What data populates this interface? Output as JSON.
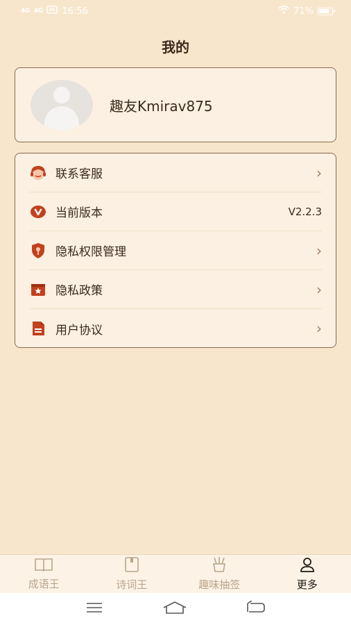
{
  "status": {
    "time": "16:56",
    "sig1": "4G",
    "sig2": "4G",
    "battery": "71%"
  },
  "page": {
    "title": "我的"
  },
  "profile": {
    "username": "趣友Kmirav875"
  },
  "menu": [
    {
      "label": "联系客服",
      "icon": "customer-service-icon",
      "right": ""
    },
    {
      "label": "当前版本",
      "icon": "version-icon",
      "right": "V2.2.3"
    },
    {
      "label": "隐私权限管理",
      "icon": "privacy-shield-icon",
      "right": ""
    },
    {
      "label": "隐私政策",
      "icon": "policy-star-icon",
      "right": ""
    },
    {
      "label": "用户协议",
      "icon": "document-icon",
      "right": ""
    }
  ],
  "tabs": [
    {
      "label": "成语王",
      "icon": "book-icon",
      "active": false
    },
    {
      "label": "诗词王",
      "icon": "notebook-icon",
      "active": false
    },
    {
      "label": "趣味抽签",
      "icon": "lottery-icon",
      "active": false
    },
    {
      "label": "更多",
      "icon": "user-icon",
      "active": true
    }
  ],
  "colors": {
    "accent": "#c2411e",
    "background": "#f8e6cc",
    "card": "#fbf0e2",
    "border": "#8a6a4e"
  }
}
